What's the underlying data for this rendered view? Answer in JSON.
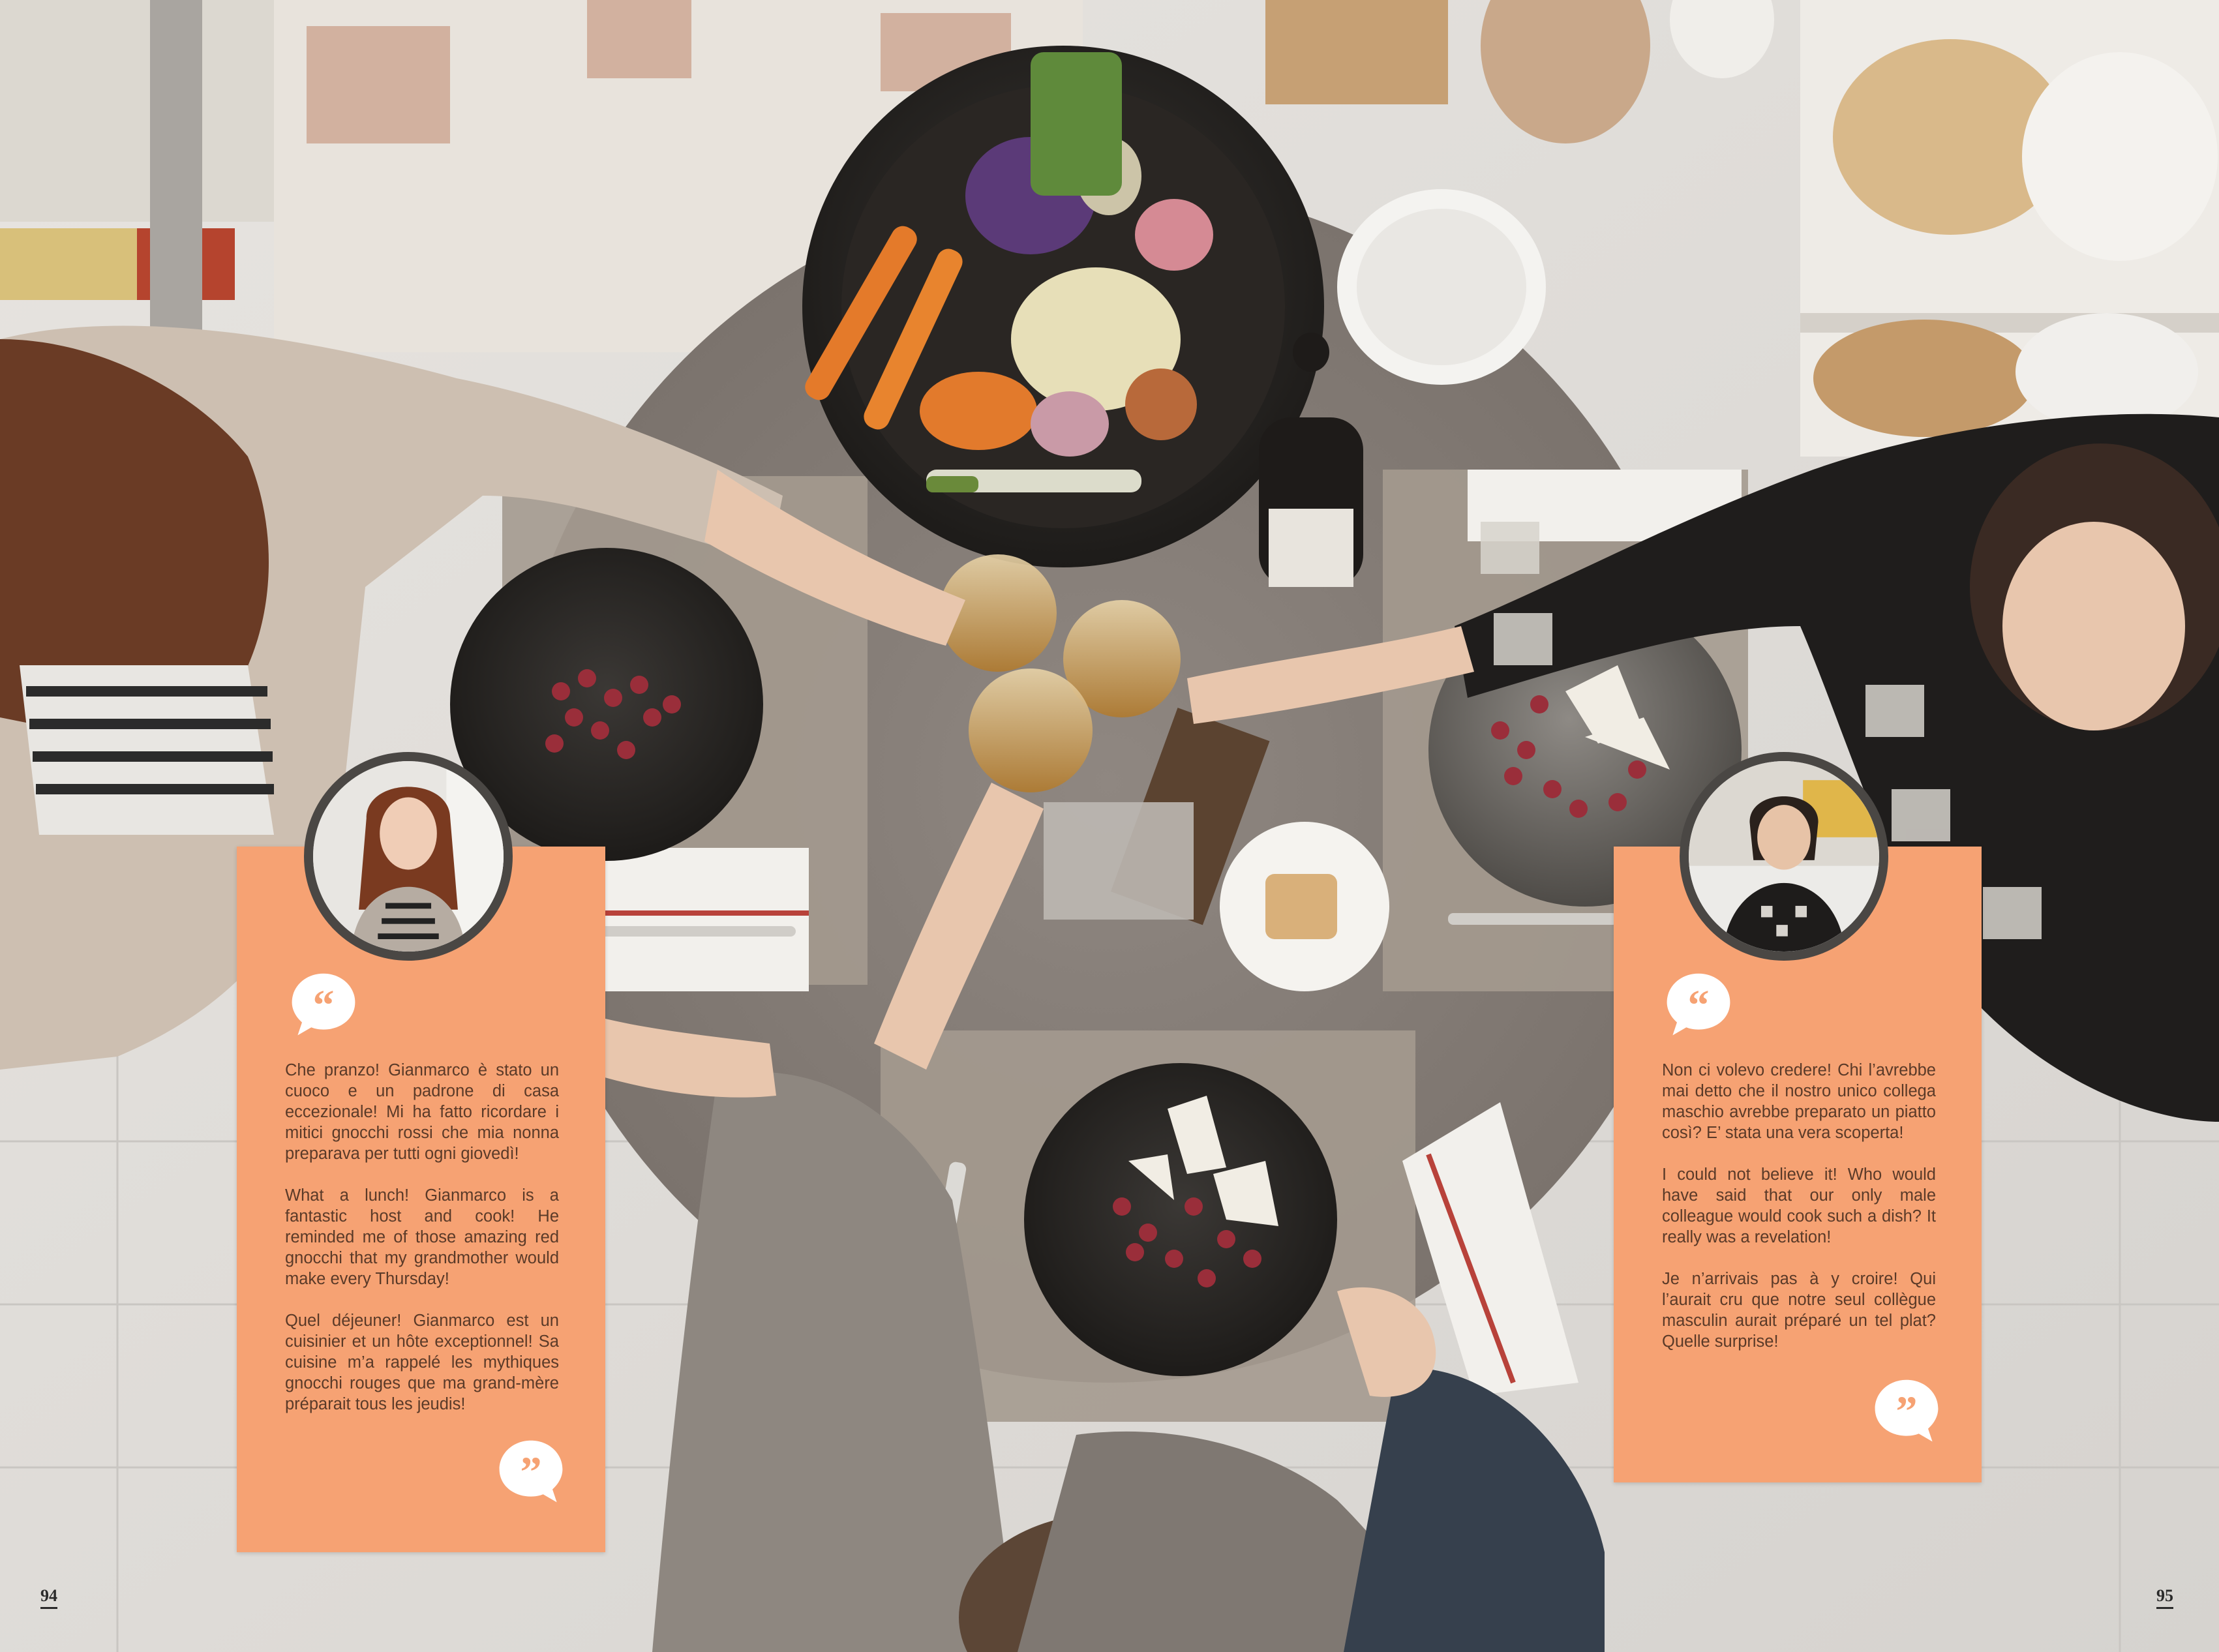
{
  "page": {
    "left_number": "94",
    "right_number": "95"
  },
  "colors": {
    "card_background": "#f6a273",
    "avatar_ring": "#4a4744",
    "card_text": "#5a3a28"
  },
  "testimonials": [
    {
      "avatar": "woman-long-red-hair-portrait",
      "quote_open_icon": "quote-open-icon",
      "quote_close_icon": "quote-close-icon",
      "paragraphs": [
        "Che pranzo! Gianmarco è stato un cuoco e un padrone di casa eccezionale! Mi ha fatto ricordare i mitici gnocchi rossi che mia nonna preparava per tutti ogni giovedì!",
        "What a lunch! Gianmarco is a fantastic host and cook! He reminded me of those amazing red gnocchi that my grandmother would make every Thursday!",
        "Quel déjeuner! Gianmarco est un cuisinier et un hôte exceptionnel! Sa cuisine m’a rappelé les mythiques gnocchi rouges que ma grand-mère préparait tous les jeudis!"
      ]
    },
    {
      "avatar": "woman-short-dark-hair-portrait",
      "quote_open_icon": "quote-open-icon",
      "quote_close_icon": "quote-close-icon",
      "paragraphs": [
        "Non ci volevo credere! Chi l’avrebbe mai detto che il nostro unico collega maschio avrebbe preparato un piatto così? E’ stata una vera scoperta!",
        "I could not believe it! Who would have said that our only male colleague would cook such a dish? It really was a revelation!",
        "Je n’arrivais pas à y croire! Qui l’aurait cru que notre seul collègue masculin aurait préparé un tel plat? Quelle surprise!"
      ]
    }
  ]
}
